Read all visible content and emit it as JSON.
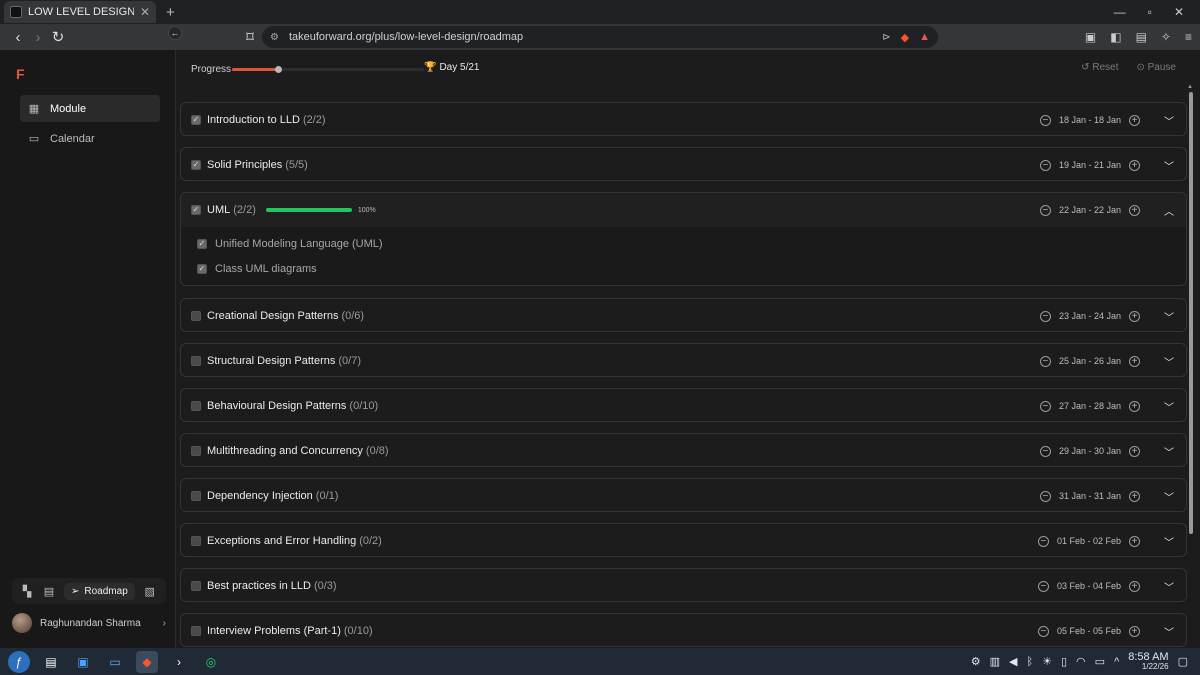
{
  "browser": {
    "tab_title": "LOW LEVEL DESIGN - Roadm",
    "url": "takeuforward.org/plus/low-level-design/roadmap"
  },
  "sidebar": {
    "logo": "F",
    "items": [
      {
        "label": "Module",
        "icon": "grid-icon",
        "active": true
      },
      {
        "label": "Calendar",
        "icon": "calendar-icon",
        "active": false
      }
    ],
    "mode_bar": {
      "roadmap_label": "Roadmap"
    },
    "user_name": "Raghunandan Sharma"
  },
  "progress": {
    "label": "Progress",
    "day_label": "Day 5/21",
    "fraction": 0.238,
    "reset_label": "Reset",
    "pause_label": "Pause"
  },
  "modules": [
    {
      "title": "Introduction to LLD",
      "count": "(2/2)",
      "dates": "18 Jan - 18 Jan",
      "checked": true
    },
    {
      "title": "Solid Principles",
      "count": "(5/5)",
      "dates": "19 Jan - 21 Jan",
      "checked": true
    },
    {
      "title": "UML",
      "count": "(2/2)",
      "dates": "22 Jan - 22 Jan",
      "checked": true,
      "expanded": true,
      "percent": "100%",
      "subitems": [
        "Unified Modeling Language (UML)",
        "Class UML diagrams"
      ]
    },
    {
      "title": "Creational Design Patterns",
      "count": "(0/6)",
      "dates": "23 Jan - 24 Jan",
      "checked": false
    },
    {
      "title": "Structural Design Patterns",
      "count": "(0/7)",
      "dates": "25 Jan - 26 Jan",
      "checked": false
    },
    {
      "title": "Behavioural Design Patterns",
      "count": "(0/10)",
      "dates": "27 Jan - 28 Jan",
      "checked": false
    },
    {
      "title": "Multithreading and Concurrency",
      "count": "(0/8)",
      "dates": "29 Jan - 30 Jan",
      "checked": false
    },
    {
      "title": "Dependency Injection",
      "count": "(0/1)",
      "dates": "31 Jan - 31 Jan",
      "checked": false
    },
    {
      "title": "Exceptions and Error Handling",
      "count": "(0/2)",
      "dates": "01 Feb - 02 Feb",
      "checked": false
    },
    {
      "title": "Best practices in LLD",
      "count": "(0/3)",
      "dates": "03 Feb - 04 Feb",
      "checked": false
    },
    {
      "title": "Interview Problems (Part-1)",
      "count": "(0/10)",
      "dates": "05 Feb - 05 Feb",
      "checked": false
    }
  ],
  "taskbar": {
    "time": "8:58 AM",
    "date": "1/22/26"
  },
  "colors": {
    "accent": "#e0533c",
    "success": "#22c55e",
    "background": "#1c1c1c"
  }
}
